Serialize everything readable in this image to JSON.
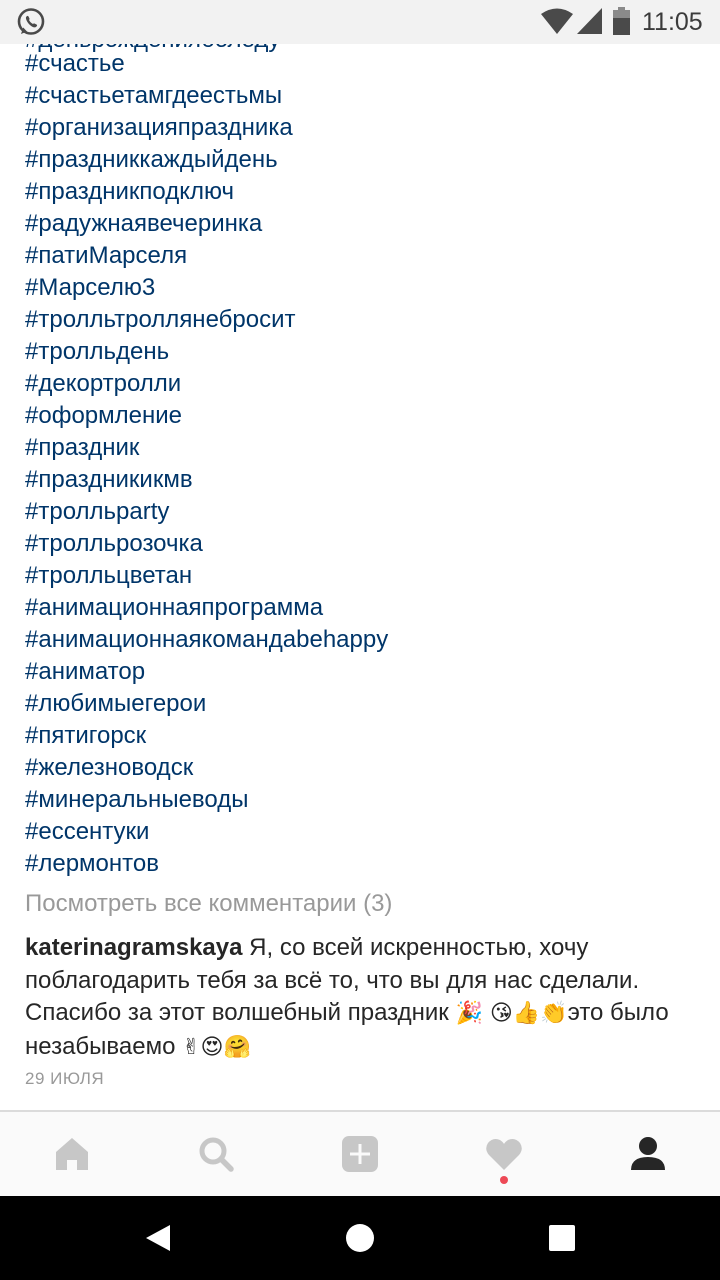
{
  "status_bar": {
    "time": "11:05",
    "icons": [
      "whatsapp-icon",
      "wifi-icon",
      "signal-icon",
      "battery-icon"
    ]
  },
  "post": {
    "cut_off_line": "#деньрожденияболеду",
    "hashtags": [
      "#счастье",
      "#счастьетамгдеестьмы",
      "#организацияпраздника",
      "#праздниккаждыйдень",
      "#праздникподключ",
      "#радужнаявечеринка",
      "#патиМарселя",
      "#Марселю3",
      "#тролльтроллянебросит",
      "#тролльдень",
      "#декортролли",
      "#оформление",
      "#праздник",
      "#праздникикмв",
      "#тролльparty",
      "#тролльрозочка",
      "#тролльцветан",
      "#анимационнаяпрограмма",
      "#анимационнаякомандаbehappy",
      "#аниматор",
      "#любимыегерои",
      "#пятигорск",
      "#железноводск",
      "#минеральныеводы",
      "#ессентуки",
      "#лермонтов"
    ],
    "view_comments": "Посмотреть все комментарии (3)",
    "comment": {
      "username": "katerinagramskaya",
      "text": " Я, со всей искренностью, хочу поблагодарить тебя за всё то, что вы для нас сделали. Спасибо за этот волшебный праздник ",
      "emojis_1": "🎉 😘👍👏",
      "text_2": "это было незабываемо ",
      "emojis_2": "✌😍🤗",
      "date": "29 ИЮЛЯ"
    }
  },
  "tab_bar": {
    "tabs": [
      "home-icon",
      "search-icon",
      "add-post-icon",
      "activity-heart-icon",
      "profile-icon"
    ],
    "active": "profile-icon",
    "colors": {
      "inactive": "#c7c7c7",
      "active": "#262626",
      "notification_dot": "#ed4956"
    }
  },
  "nav_bar": {
    "buttons": [
      "back-icon",
      "home-circle-icon",
      "recents-icon"
    ]
  },
  "colors": {
    "hashtag": "#003569",
    "text": "#262626",
    "muted": "#999999"
  }
}
